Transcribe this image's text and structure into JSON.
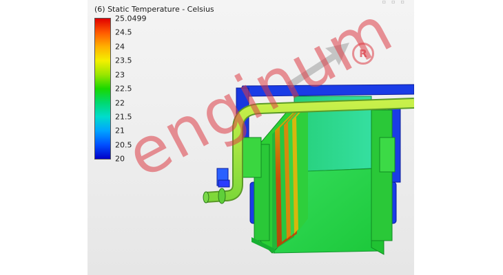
{
  "view": {
    "title": "(6) Static Temperature - Celsius"
  },
  "legend": {
    "labels": [
      "25.0499",
      "24.5",
      "24",
      "23.5",
      "23",
      "22.5",
      "22",
      "21.5",
      "21",
      "20.5",
      "20"
    ],
    "gradient_colors": [
      "#e00000",
      "#ff5a00",
      "#ffb000",
      "#f4f000",
      "#9ae600",
      "#19d800",
      "#00d970",
      "#00dccc",
      "#00a4ff",
      "#0050ff",
      "#0000c8"
    ]
  },
  "watermark": {
    "text": "enginum",
    "symbol": "R",
    "color": "#dc3c46"
  },
  "corner_icons": [
    "minimize-icon",
    "restore-icon",
    "close-icon"
  ],
  "colors": {
    "pipe_blue": "#1a3ce6",
    "pipe_green": "#9ce646",
    "body_green": "#2ad23a",
    "deep_green": "#1cba2c"
  }
}
